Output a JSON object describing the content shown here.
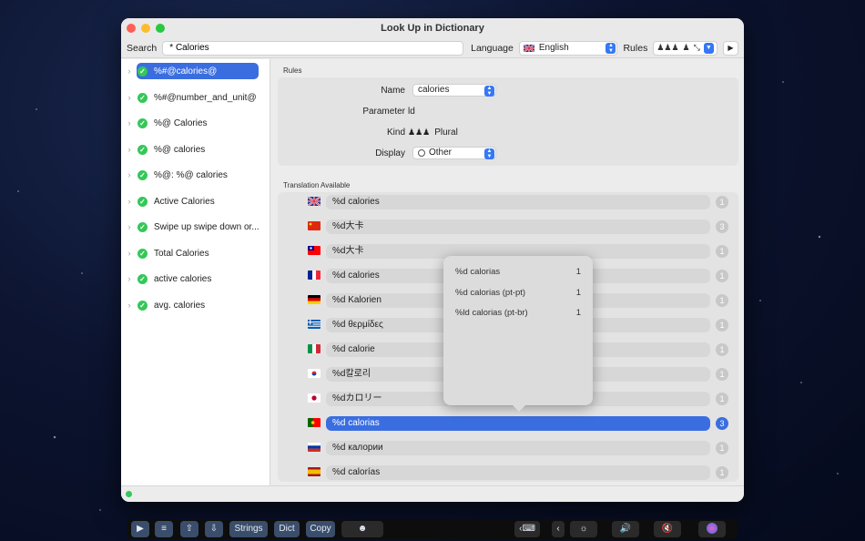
{
  "window": {
    "title": "Look Up in Dictionary"
  },
  "toolbar": {
    "search_label": "Search",
    "search_value": "* Calories",
    "language_label": "Language",
    "language_value": "English",
    "rules_label": "Rules"
  },
  "sidebar": {
    "items": [
      {
        "label": "%#@calories@",
        "selected": true
      },
      {
        "label": "%#@number_and_unit@",
        "selected": false
      },
      {
        "label": "%@ Calories",
        "selected": false
      },
      {
        "label": "%@ calories",
        "selected": false
      },
      {
        "label": "%@: %@ calories",
        "selected": false
      },
      {
        "label": "Active Calories",
        "selected": false
      },
      {
        "label": "Swipe up swipe down or...",
        "selected": false
      },
      {
        "label": "Total Calories",
        "selected": false
      },
      {
        "label": "active calories",
        "selected": false
      },
      {
        "label": "avg. calories",
        "selected": false
      }
    ]
  },
  "rules": {
    "section_title": "Rules",
    "name_label": "Name",
    "name_value": "calories",
    "parameter_label": "Parameter",
    "parameter_value": "ld",
    "kind_label": "Kind",
    "kind_value": "Plural",
    "display_label": "Display",
    "display_value": "Other"
  },
  "translations": {
    "section_title": "Translation Available",
    "rows": [
      {
        "flag": "flag-gb-icon",
        "text": "%d calories",
        "count": "1"
      },
      {
        "flag": "flag-cn-icon",
        "text": "%d大卡",
        "count": "3"
      },
      {
        "flag": "flag-tw-icon",
        "text": "%d大卡",
        "count": "1"
      },
      {
        "flag": "flag-fr-icon",
        "text": "%d calories",
        "count": "1"
      },
      {
        "flag": "flag-de-icon",
        "text": "%d Kalorien",
        "count": "1"
      },
      {
        "flag": "flag-gr-icon",
        "text": "%d θερμίδες",
        "count": "1"
      },
      {
        "flag": "flag-it-icon",
        "text": "%d calorie",
        "count": "1"
      },
      {
        "flag": "flag-kr-icon",
        "text": "%d칼로리",
        "count": "1"
      },
      {
        "flag": "flag-jp-icon",
        "text": "%dカロリー",
        "count": "1"
      },
      {
        "flag": "flag-pt-icon",
        "text": "%d calorias",
        "count": "3",
        "selected": true
      },
      {
        "flag": "flag-ru-icon",
        "text": "%d калории",
        "count": "1"
      },
      {
        "flag": "flag-es-icon",
        "text": "%d calorías",
        "count": "1"
      }
    ]
  },
  "popover": {
    "rows": [
      {
        "text": "%d calorias",
        "count": "1"
      },
      {
        "text": "%d calorias (pt-pt)",
        "count": "1"
      },
      {
        "text": "%ld calorias (pt-br)",
        "count": "1"
      }
    ]
  },
  "touchbar": {
    "strings_label": "Strings",
    "dict_label": "Dict",
    "copy_label": "Copy"
  },
  "colors": {
    "accent": "#3a6ee0",
    "success": "#34c759"
  }
}
